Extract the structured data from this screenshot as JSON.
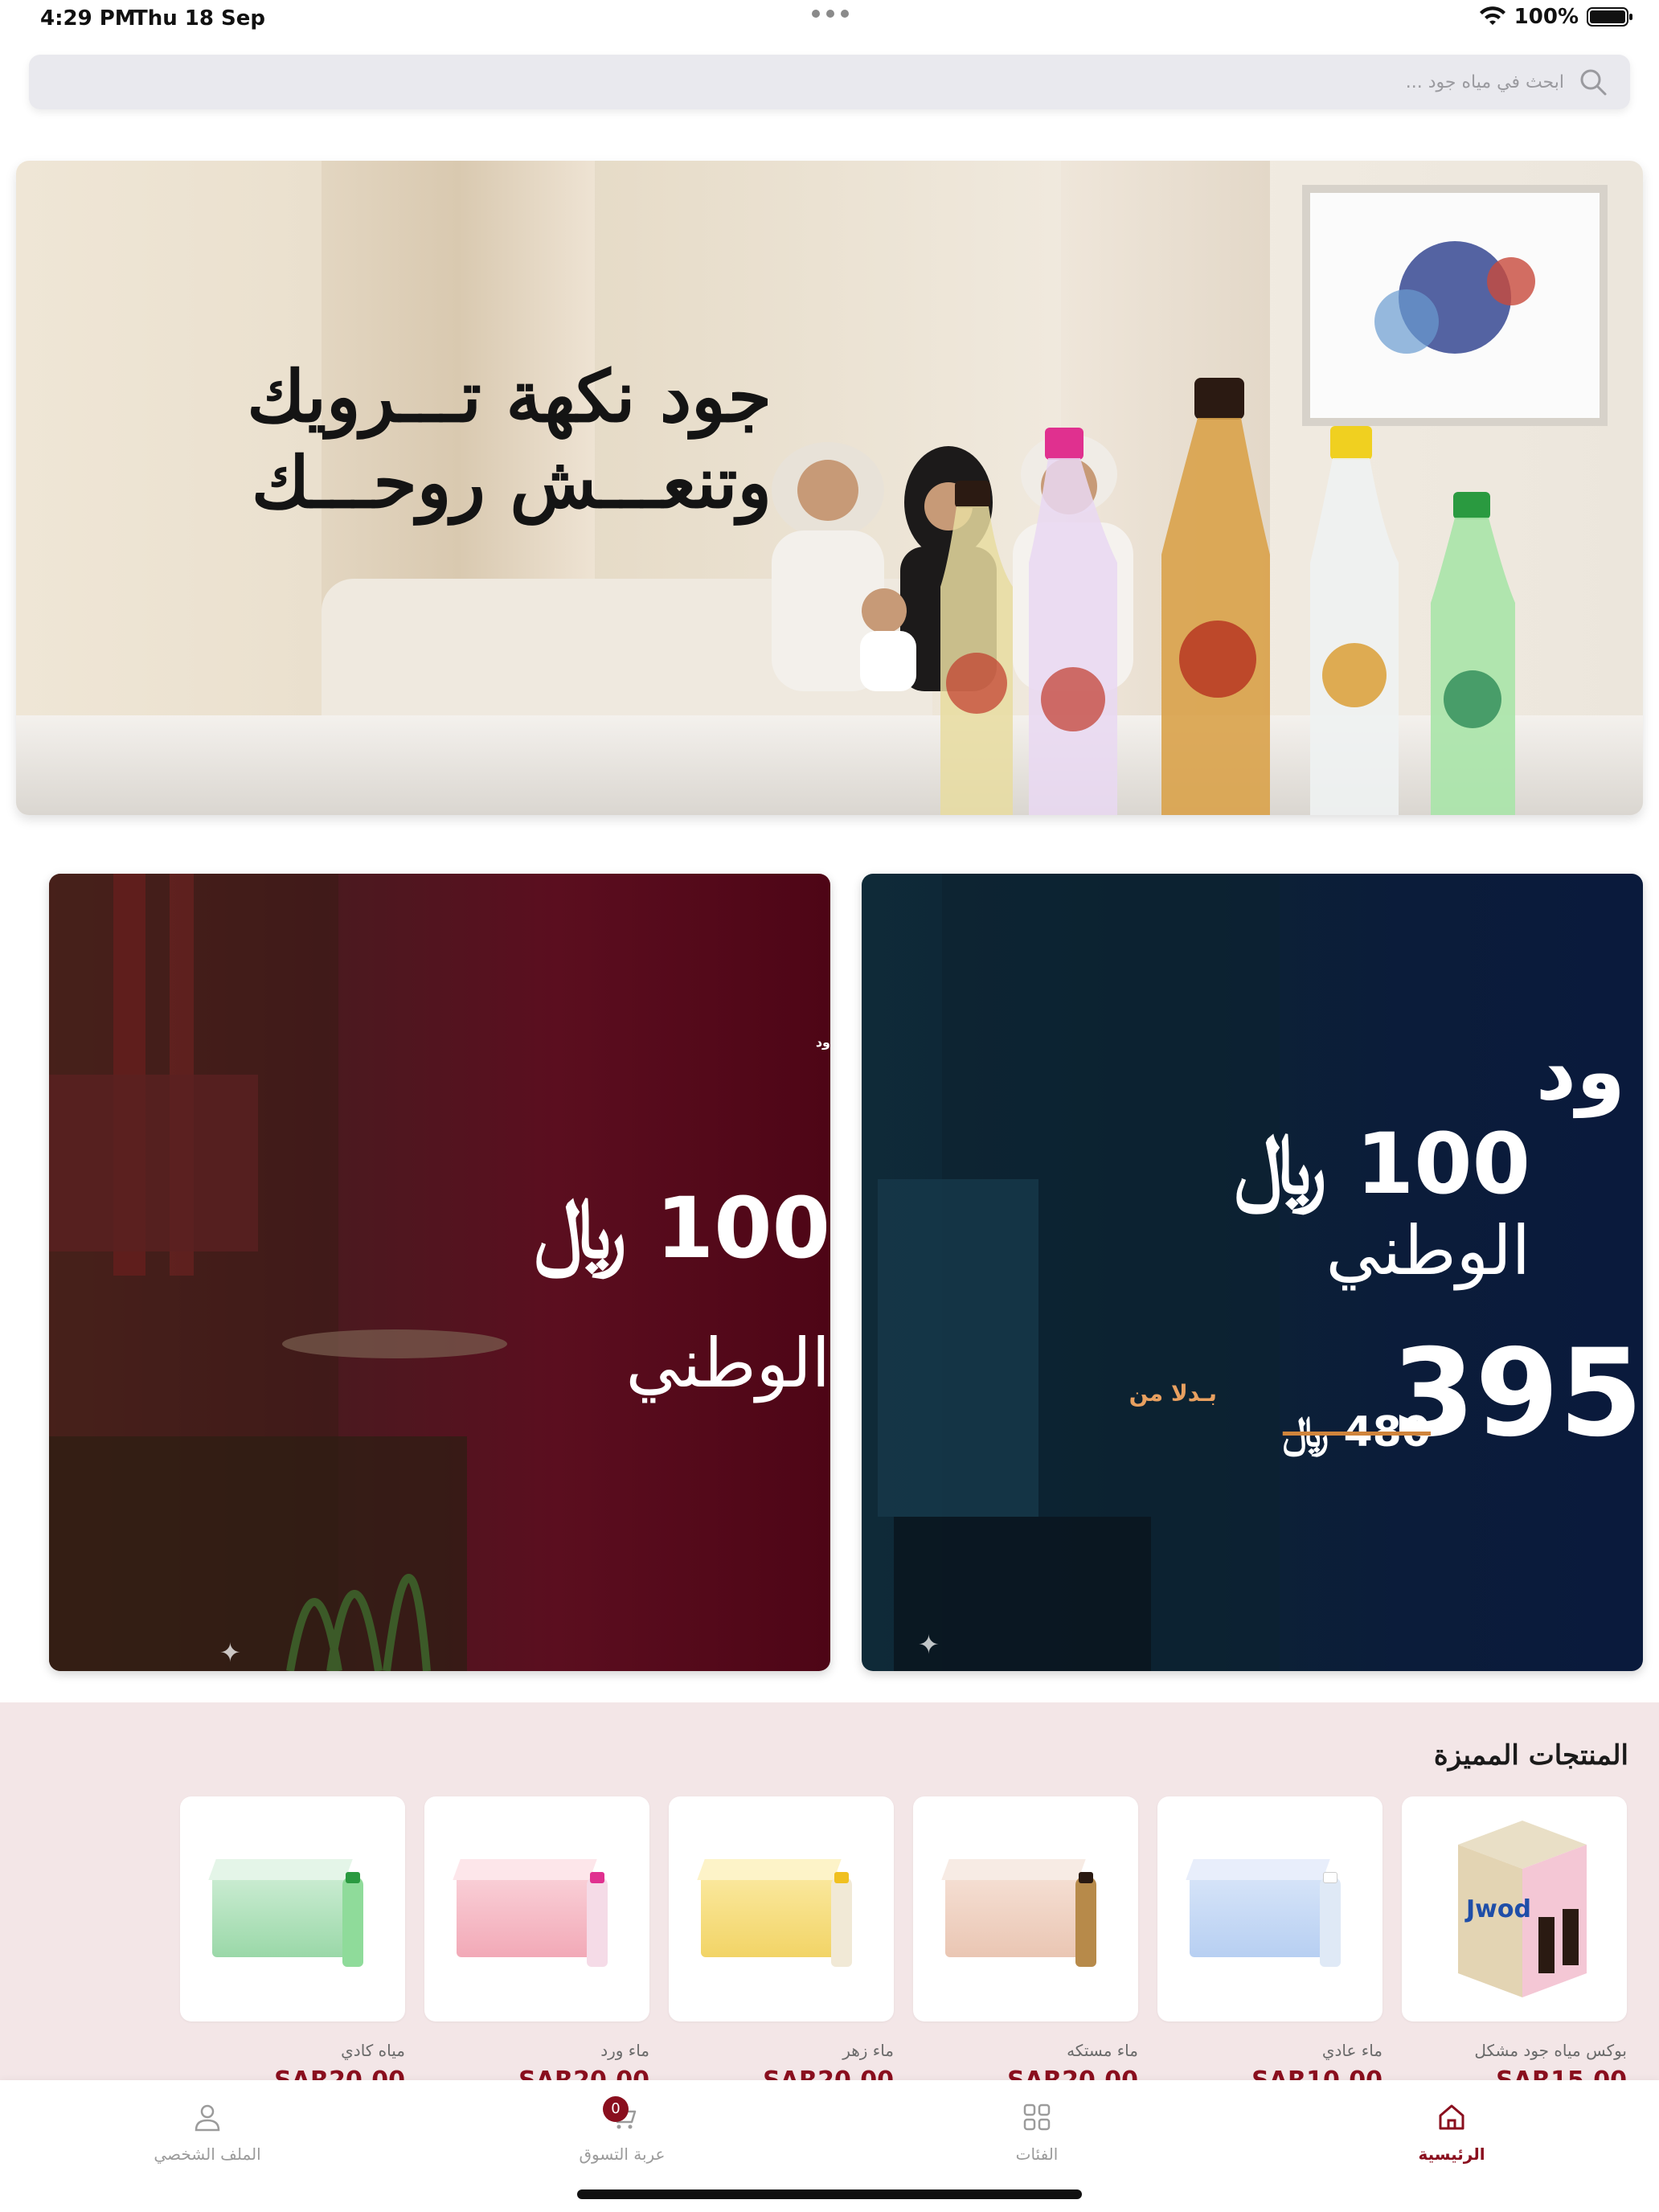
{
  "status_bar": {
    "time": "4:29 PM",
    "date": "Thu 18 Sep",
    "battery": "100%"
  },
  "search": {
    "placeholder": "ابحث في مياه جود ..."
  },
  "hero": {
    "line1": "جود نكهة تـــرويك",
    "line2": "وتنعـــش روحـــك"
  },
  "promos": [
    {
      "brand": "ود",
      "amount": "100 ﷼",
      "national": "الوطني"
    },
    {
      "brand": "ود",
      "amount": "100 ﷼",
      "national": "الوطني",
      "price": "395",
      "was_label": "بـدلا من",
      "was": "480 ﷼"
    }
  ],
  "featured": {
    "title": "المنتجات المميزة",
    "products": [
      {
        "name": "بوكس مياه جود مشكل",
        "price": "SAR15.00"
      },
      {
        "name": "ماء عادي",
        "price": "SAR10.00"
      },
      {
        "name": "ماء مستكه",
        "price": "SAR20.00"
      },
      {
        "name": "ماء زهر",
        "price": "SAR20.00"
      },
      {
        "name": "ماء ورد",
        "price": "SAR20.00"
      },
      {
        "name": "مياه كادي",
        "price": "SAR20.00"
      }
    ]
  },
  "tabbar": {
    "home": "الرئيسية",
    "categories": "الفئات",
    "cart": "عربة التسوق",
    "cart_count": "0",
    "profile": "الملف الشخصي"
  },
  "colors": {
    "accent": "#8a0f1e",
    "featured_bg": "#f3e6e7",
    "search_bg": "#e9e9ee"
  }
}
